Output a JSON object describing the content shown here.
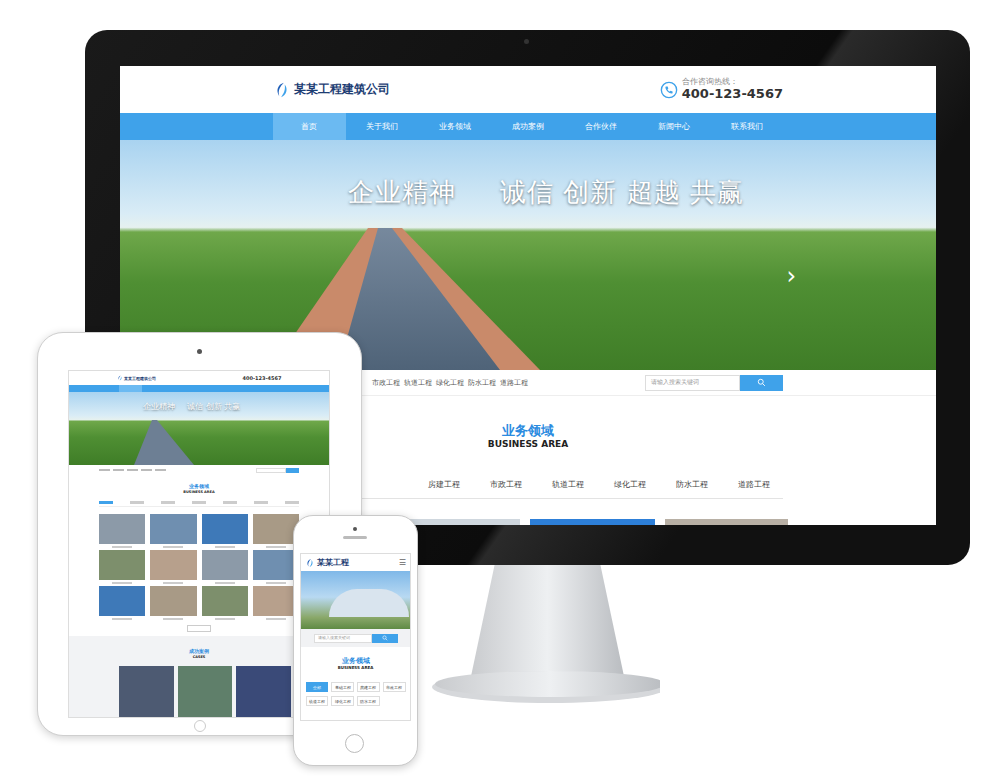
{
  "desktop": {
    "logo": "某某工程建筑公司",
    "hotline_label": "合作咨询热线：",
    "hotline": "400-123-4567",
    "nav": [
      {
        "label": "首页",
        "selected": true
      },
      {
        "label": "关于我们",
        "selected": false
      },
      {
        "label": "业务领域",
        "selected": false
      },
      {
        "label": "成功案例",
        "selected": false
      },
      {
        "label": "合作伙伴",
        "selected": false
      },
      {
        "label": "新闻中心",
        "selected": false
      },
      {
        "label": "联系我们",
        "selected": false
      }
    ],
    "banner": {
      "motto_title": "企业精神",
      "motto": "诚信 创新 超越 共赢",
      "next": "›"
    },
    "hot_keywords": [
      "市政工程",
      "轨道工程",
      "绿化工程",
      "防水工程",
      "道路工程"
    ],
    "search": {
      "placeholder": "请输入搜索关键词"
    },
    "section": {
      "title": "业务领域",
      "subtitle": "BUSINESS AREA"
    },
    "tabs": [
      {
        "label": "房建工程",
        "selected": false
      },
      {
        "label": "市政工程",
        "selected": false
      },
      {
        "label": "轨道工程",
        "selected": false
      },
      {
        "label": "绿化工程",
        "selected": false
      },
      {
        "label": "防水工程",
        "selected": false
      },
      {
        "label": "道路工程",
        "selected": false
      }
    ]
  },
  "tablet": {
    "logo": "某某工程建筑公司",
    "hotline": "400-123-4567",
    "banner": {
      "motto_title": "企业精神",
      "motto": "诚信 创新 共赢"
    },
    "section": {
      "title": "业务领域",
      "subtitle": "BUSINESS AREA"
    },
    "cases": {
      "title": "成功案例",
      "subtitle": "CASES"
    }
  },
  "phone": {
    "logo": "某某工程",
    "menu": "☰",
    "search": {
      "placeholder": "请输入搜索关键词"
    },
    "section": {
      "title": "业务领域",
      "subtitle": "BUSINESS AREA"
    },
    "tabs": [
      {
        "label": "全部",
        "selected": true
      },
      {
        "label": "基础工程",
        "selected": false
      },
      {
        "label": "房建工程",
        "selected": false
      },
      {
        "label": "市政工程",
        "selected": false
      },
      {
        "label": "轨道工程",
        "selected": false
      },
      {
        "label": "绿化工程",
        "selected": false
      },
      {
        "label": "防水工程",
        "selected": false
      }
    ]
  }
}
